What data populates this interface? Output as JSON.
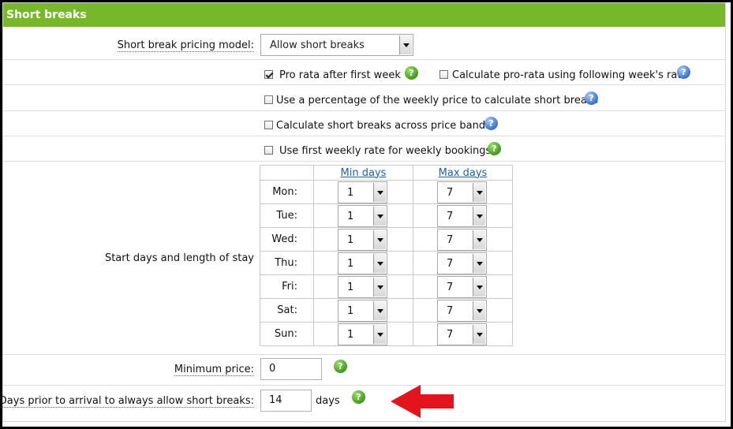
{
  "section": {
    "title": "Short breaks"
  },
  "pricing_model": {
    "label": "Short break pricing model:",
    "value": "Allow short breaks"
  },
  "options": {
    "pro_rata": {
      "label": "Pro rata after first week",
      "checked": true
    },
    "pro_rata_following": {
      "label": "Calculate pro-rata using following week's rate",
      "checked": false
    },
    "percentage": {
      "label": "Use a percentage of the weekly price to calculate short breaks",
      "checked": false
    },
    "across_bands": {
      "label": "Calculate short breaks across price bands",
      "checked": false
    },
    "first_weekly": {
      "label": "Use first weekly rate for weekly bookings",
      "checked": false
    }
  },
  "start_days": {
    "label": "Start days and length of stay",
    "min_header": "Min days",
    "max_header": "Max days",
    "rows": [
      {
        "day": "Mon:",
        "min": "1",
        "max": "7"
      },
      {
        "day": "Tue:",
        "min": "1",
        "max": "7"
      },
      {
        "day": "Wed:",
        "min": "1",
        "max": "7"
      },
      {
        "day": "Thu:",
        "min": "1",
        "max": "7"
      },
      {
        "day": "Fri:",
        "min": "1",
        "max": "7"
      },
      {
        "day": "Sat:",
        "min": "1",
        "max": "7"
      },
      {
        "day": "Sun:",
        "min": "1",
        "max": "7"
      }
    ]
  },
  "minimum_price": {
    "label": "Minimum price:",
    "value": "0"
  },
  "days_prior": {
    "label": "Days prior to arrival to always allow short breaks:",
    "value": "14",
    "unit": "days"
  },
  "help_glyph": "?",
  "colors": {
    "header": "#77b82b",
    "help_green": "#3f9a1a",
    "help_blue": "#3a74c9",
    "annotation_arrow": "#e3141b",
    "link": "#1d5fa8"
  }
}
